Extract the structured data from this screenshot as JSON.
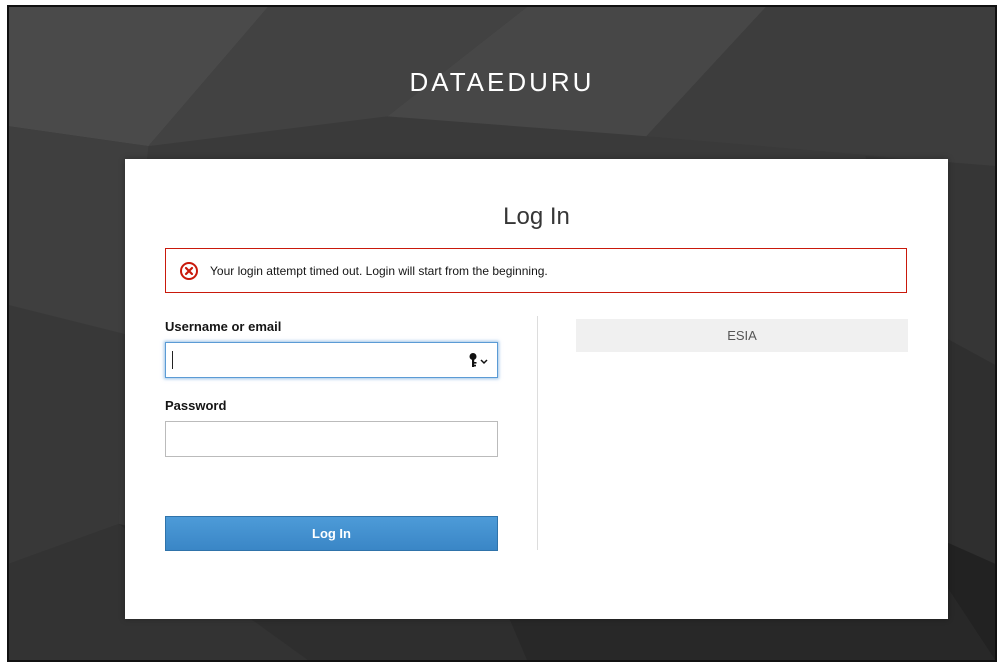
{
  "brand": {
    "title": "DATAEDURU"
  },
  "login_card": {
    "title": "Log In",
    "alert": {
      "message": "Your login attempt timed out. Login will start from the beginning.",
      "icon": "error-circle-icon",
      "color": "#c9190b"
    },
    "username": {
      "label": "Username or email",
      "value": "",
      "icon": "key-dropdown-icon"
    },
    "password": {
      "label": "Password",
      "value": ""
    },
    "submit_label": "Log In",
    "identity_providers": [
      {
        "label": "ESIA"
      }
    ]
  },
  "colors": {
    "primary_button": "#3a86c6",
    "alert_border": "#c9190b",
    "background": "#3a3a3a"
  }
}
